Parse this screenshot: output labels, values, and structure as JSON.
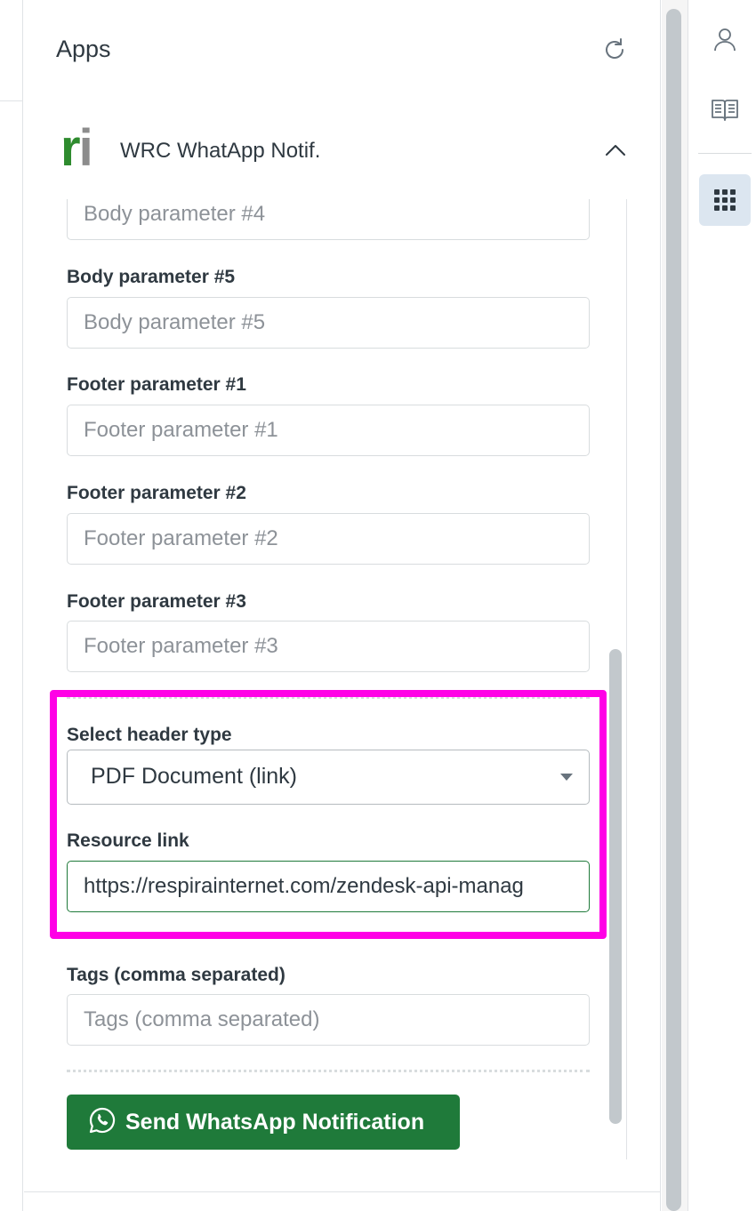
{
  "apps_panel": {
    "title": "Apps",
    "app": {
      "logo_r": "r",
      "logo_i": "i",
      "name": "WRC WhatApp Notif."
    }
  },
  "form": {
    "body_param_4": {
      "placeholder": "Body parameter #4"
    },
    "body_param_5": {
      "label": "Body parameter #5",
      "placeholder": "Body parameter #5"
    },
    "footer_param_1": {
      "label": "Footer parameter #1",
      "placeholder": "Footer parameter #1"
    },
    "footer_param_2": {
      "label": "Footer parameter #2",
      "placeholder": "Footer parameter #2"
    },
    "footer_param_3": {
      "label": "Footer parameter #3",
      "placeholder": "Footer parameter #3"
    },
    "header_type": {
      "label": "Select header type",
      "value": "PDF Document (link)"
    },
    "resource_link": {
      "label": "Resource link",
      "value": "https://respirainternet.com/zendesk-api-manag"
    },
    "tags": {
      "label": "Tags (comma separated)",
      "placeholder": "Tags (comma separated)"
    },
    "send_button_label": "Send WhatsApp Notification"
  },
  "colors": {
    "accent_green": "#1f7a3a",
    "highlight": "#ff00e6",
    "active_rail": "#dce6f0"
  },
  "icons": {
    "refresh": "refresh-icon",
    "collapse": "chevron-up-icon",
    "whatsapp": "whatsapp-icon",
    "user": "user-icon",
    "knowledge": "book-icon",
    "apps": "apps-grid-icon"
  }
}
